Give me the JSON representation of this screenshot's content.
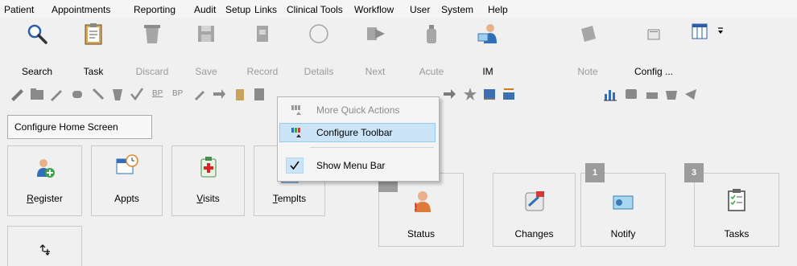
{
  "menu": [
    "Patient",
    "Appointments",
    "Reporting",
    "Audit",
    "Setup",
    "Links",
    "Clinical Tools",
    "Workflow",
    "User",
    "System",
    "Help"
  ],
  "toolbar": {
    "buttons": [
      {
        "label": "Search",
        "enabled": true,
        "icon": "magnifier-icon"
      },
      {
        "label": "Task",
        "enabled": true,
        "icon": "clipboard-icon"
      },
      {
        "label": "Discard",
        "enabled": false,
        "icon": "trash-icon"
      },
      {
        "label": "Save",
        "enabled": false,
        "icon": "floppy-icon"
      },
      {
        "label": "Record",
        "enabled": false,
        "icon": "record-icon"
      },
      {
        "label": "Details",
        "enabled": false,
        "icon": "circle-icon"
      },
      {
        "label": "Next",
        "enabled": false,
        "icon": "next-arrow-icon"
      },
      {
        "label": "Acute",
        "enabled": false,
        "icon": "bottle-icon"
      },
      {
        "label": "IM",
        "enabled": true,
        "icon": "person-mail-icon"
      },
      {
        "label": "Note",
        "enabled": false,
        "icon": "note-icon"
      },
      {
        "label": "Config ...",
        "enabled": true,
        "icon": "config-icon"
      }
    ],
    "overflow_icon": "chevron-more-icon"
  },
  "quick_toolbar": {
    "bp_labels": [
      "BP",
      "BP"
    ]
  },
  "configure_home_screen": "Configure Home Screen",
  "tiles": [
    {
      "label_u": "R",
      "label_rest": "egister",
      "icon": "person-add-icon"
    },
    {
      "label_u": "",
      "label_rest": "Appts",
      "icon": "calendar-clock-icon"
    },
    {
      "label_u": "V",
      "label_rest": "isits",
      "icon": "medical-kit-icon"
    },
    {
      "label_u": "T",
      "label_rest": "emplts",
      "icon": "template-icon"
    },
    {
      "label_u": "",
      "label_rest": "Status",
      "icon": "person-alert-icon"
    },
    {
      "label_u": "",
      "label_rest": "Changes",
      "icon": "changes-icon"
    },
    {
      "label_u": "",
      "label_rest": "Notify",
      "icon": "mail-notify-icon",
      "badge": "1"
    },
    {
      "label_u": "",
      "label_rest": "Tasks",
      "icon": "tasks-icon",
      "badge": "3"
    }
  ],
  "context_menu": {
    "items": [
      {
        "label": "More Quick Actions",
        "enabled": false
      },
      {
        "label": "Configure Toolbar",
        "enabled": true,
        "highlighted": true
      },
      {
        "label": "Show Menu Bar",
        "enabled": true,
        "checked": true
      }
    ]
  },
  "colors": {
    "accent": "#cce4f7",
    "accent_border": "#99c9ef",
    "badge": "#9c9c9c"
  }
}
